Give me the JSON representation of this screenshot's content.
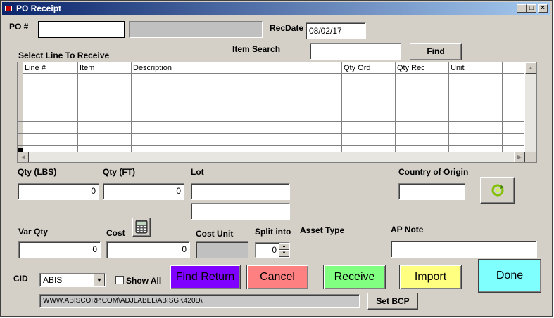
{
  "window": {
    "title": "PO Receipt"
  },
  "po": {
    "label": "PO #",
    "value": "",
    "vendor": ""
  },
  "recdate": {
    "label": "RecDate",
    "value": "08/02/17"
  },
  "item_search": {
    "label": "Item Search",
    "value": "",
    "find_label": "Find"
  },
  "lines": {
    "label": "Select Line To Receive",
    "columns": [
      "Line #",
      "Item",
      "Description",
      "Qty Ord",
      "Qty Rec",
      "Unit"
    ]
  },
  "qty_lbs": {
    "label": "Qty (LBS)",
    "value": "0"
  },
  "qty_ft": {
    "label": "Qty (FT)",
    "value": "0"
  },
  "lot": {
    "label": "Lot",
    "value1": "",
    "value2": ""
  },
  "country": {
    "label": "Country of Origin",
    "value": ""
  },
  "var_qty": {
    "label": "Var Qty",
    "value": "0"
  },
  "cost": {
    "label": "Cost",
    "value": "0"
  },
  "cost_unit": {
    "label": "Cost Unit",
    "value": ""
  },
  "split": {
    "label": "Split into",
    "value": "0"
  },
  "asset_type": {
    "label": "Asset Type"
  },
  "ap_note": {
    "label": "AP Note",
    "value": ""
  },
  "cid": {
    "label": "CID",
    "value": "ABIS"
  },
  "show_all": {
    "label": "Show All",
    "checked": false
  },
  "path": {
    "value": "WWW.ABISCORP.COM\\ADJLABEL\\ABISGK420D\\"
  },
  "buttons": {
    "find_return": "Find Return",
    "cancel": "Cancel",
    "receive": "Receive",
    "import": "Import",
    "done": "Done",
    "set_bcp": "Set BCP"
  },
  "colors": {
    "find_return": "#8000ff",
    "cancel": "#ff8080",
    "receive": "#80ff80",
    "import": "#ffff80",
    "done": "#80ffff",
    "refresh": "#80c000"
  },
  "icons": [
    "calculator-icon",
    "refresh-icon"
  ]
}
